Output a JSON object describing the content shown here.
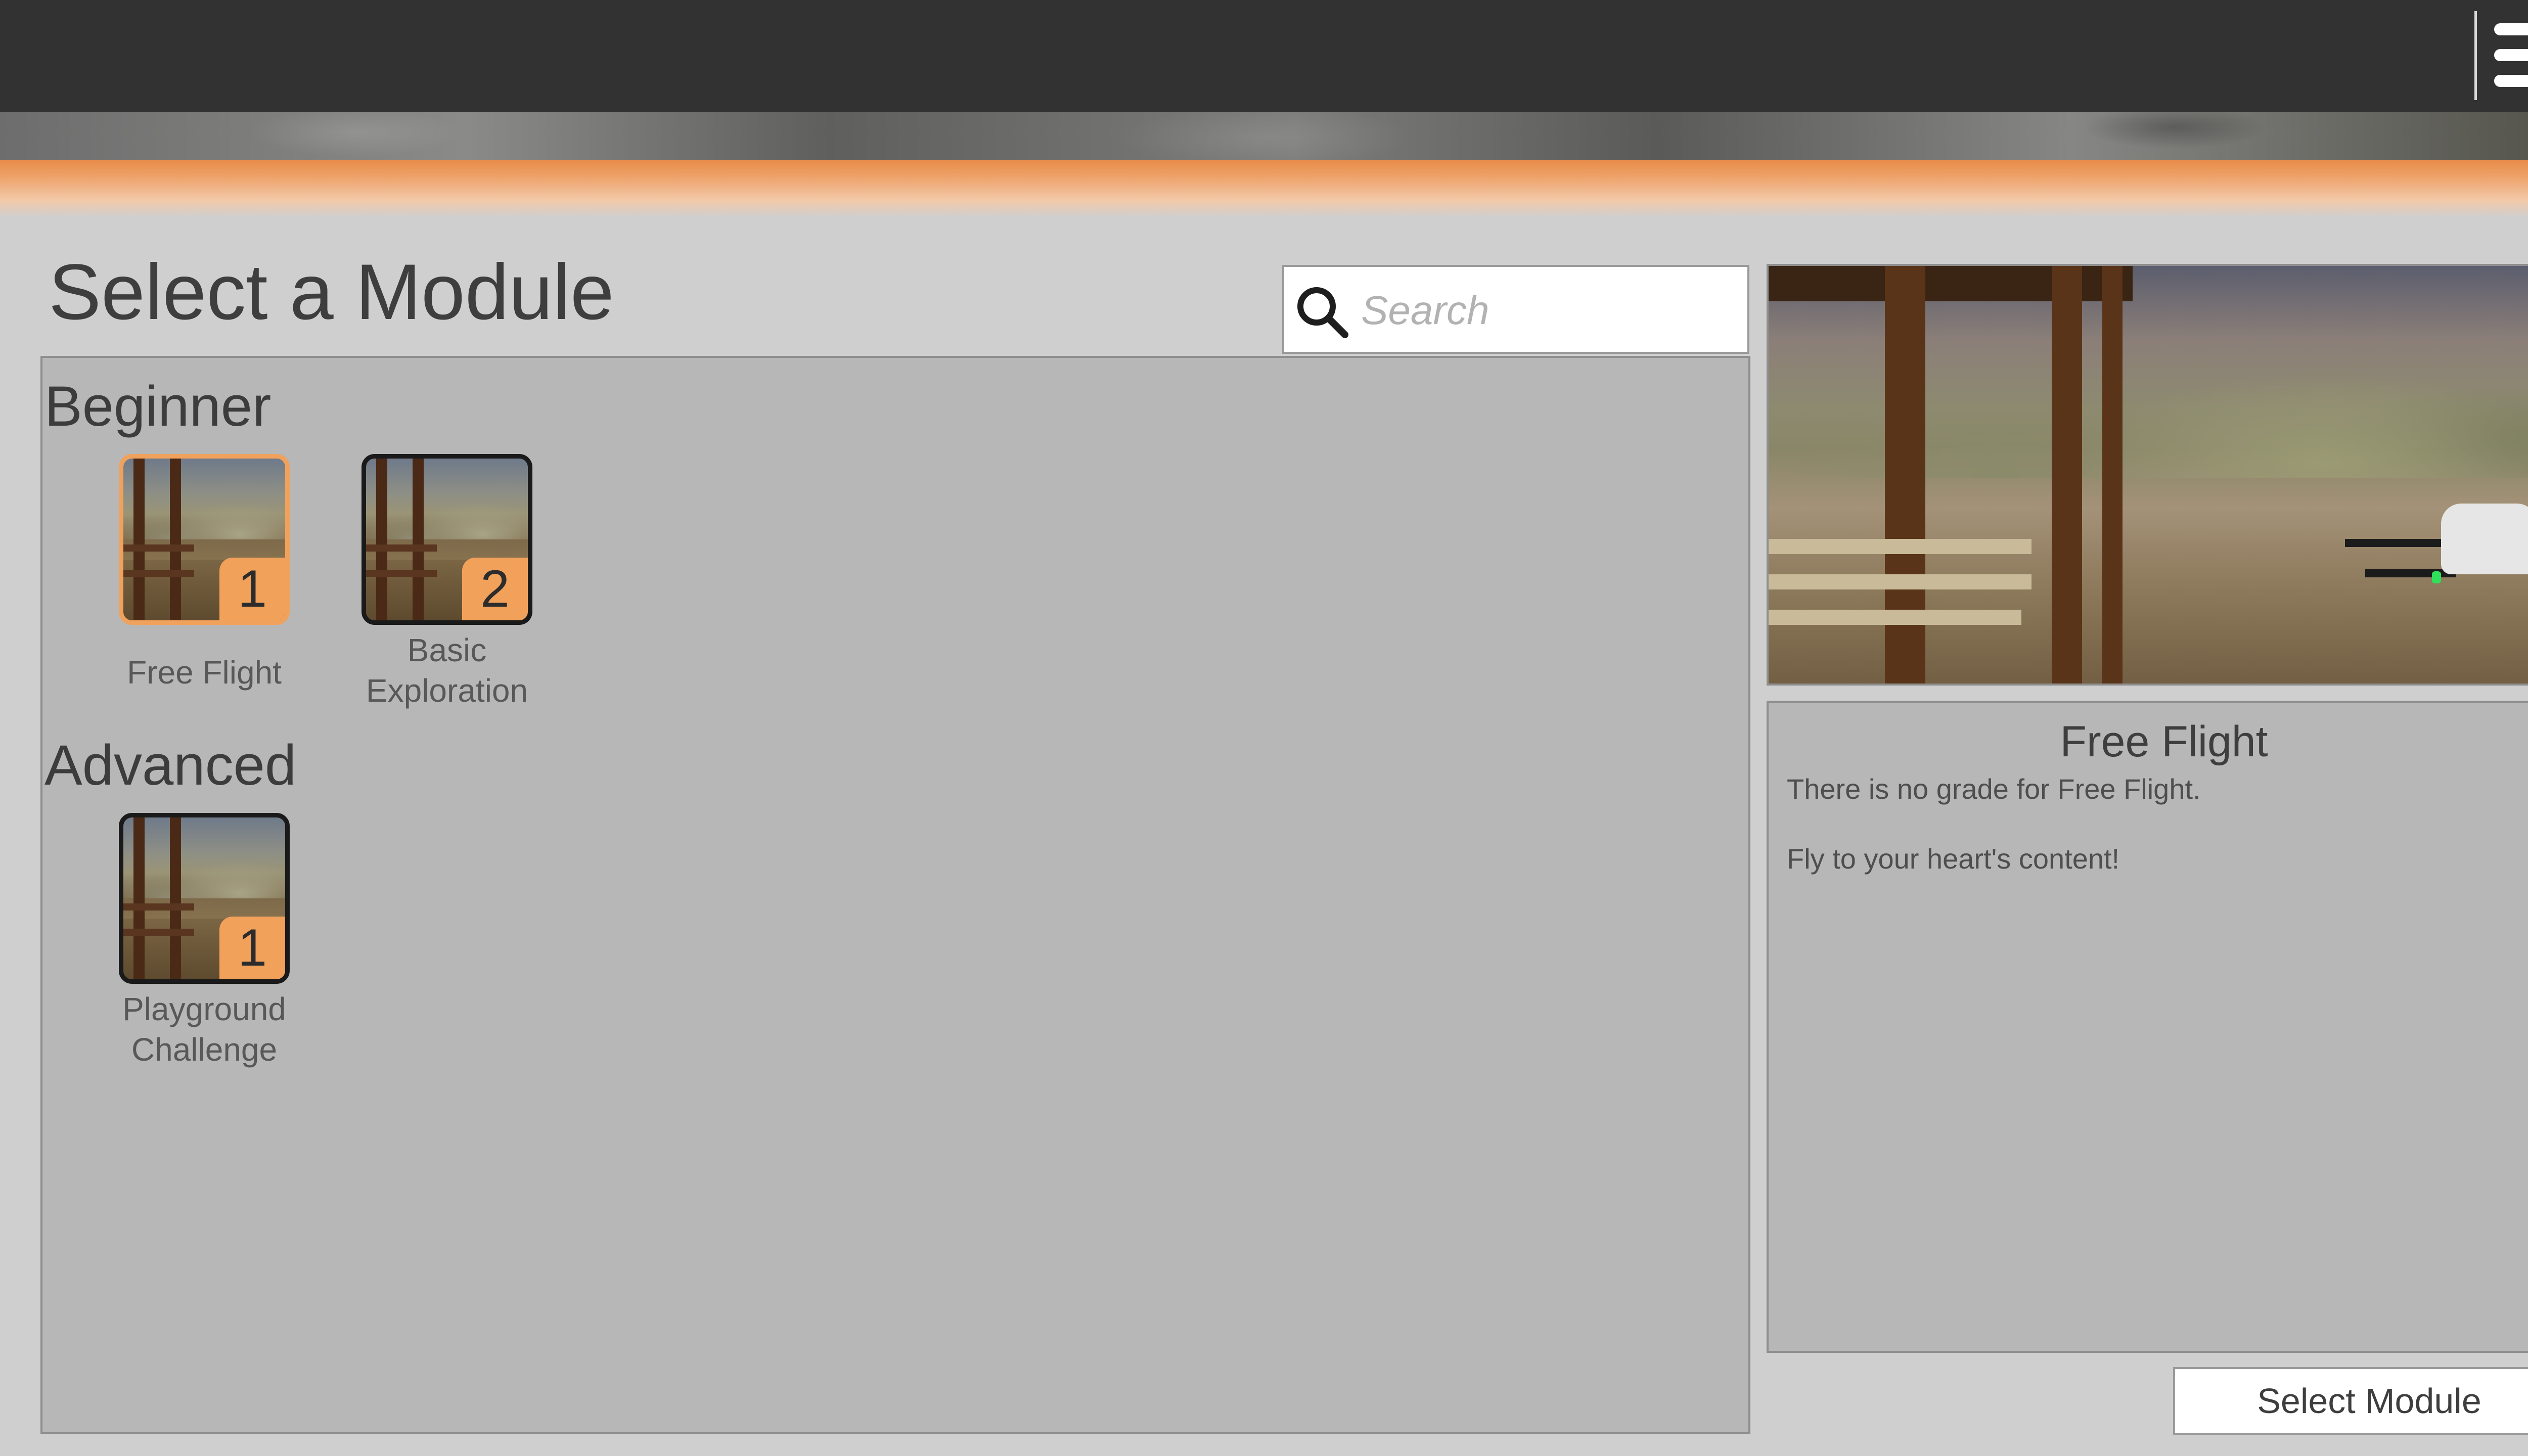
{
  "header": {
    "menu_icon": "hamburger-menu-icon"
  },
  "colors": {
    "accent": "#f2a15a",
    "topbar": "#323232",
    "panel": "#b7b7b7",
    "background": "#cfcfcf"
  },
  "page": {
    "title": "Select a Module"
  },
  "search": {
    "icon": "search-icon",
    "placeholder": "Search",
    "value": ""
  },
  "sections": [
    {
      "heading": "Beginner",
      "modules": [
        {
          "label": "Free Flight",
          "badge": "1",
          "selected": true
        },
        {
          "label": "Basic\nExploration",
          "badge": "2",
          "selected": false
        }
      ]
    },
    {
      "heading": "Advanced",
      "modules": [
        {
          "label": "Playground\nChallenge",
          "badge": "1",
          "selected": false
        }
      ]
    }
  ],
  "details": {
    "title": "Free Flight",
    "line1": "There is no grade for Free Flight.",
    "line2": "Fly to your heart's content!"
  },
  "actions": {
    "select_label": "Select Module"
  }
}
